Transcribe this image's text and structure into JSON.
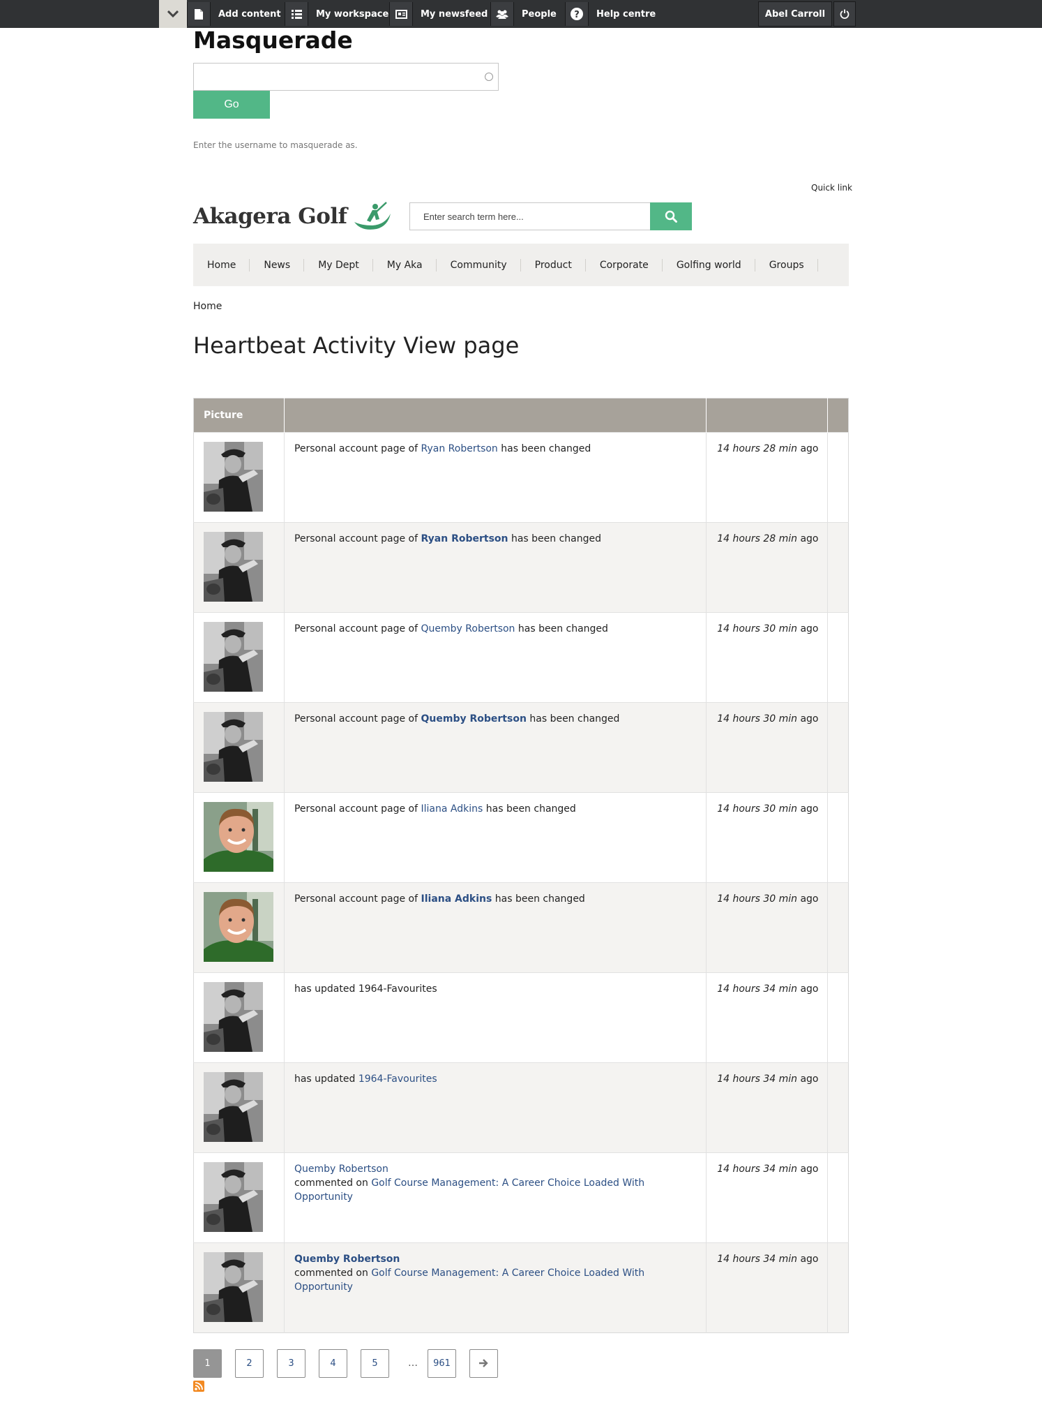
{
  "toolbar": {
    "items": [
      {
        "label": "Add content",
        "icon": "file-icon"
      },
      {
        "label": "My workspace",
        "icon": "list-icon"
      },
      {
        "label": "My newsfeed",
        "icon": "newspaper-icon"
      },
      {
        "label": "People",
        "icon": "users-icon"
      },
      {
        "label": "Help centre",
        "icon": "question-icon"
      }
    ],
    "user": "Abel Carroll"
  },
  "masquerade": {
    "title": "Masquerade",
    "input_value": "",
    "go_label": "Go",
    "help": "Enter the username to masquerade as."
  },
  "header": {
    "quick_link": "Quick link",
    "logo_text": "Akagera Golf",
    "search_placeholder": "Enter search term here..."
  },
  "nav": [
    "Home",
    "News",
    "My Dept",
    "My Aka",
    "Community",
    "Product",
    "Corporate",
    "Golfing world",
    "Groups"
  ],
  "breadcrumb": "Home",
  "page_title": "Heartbeat Activity View page",
  "table": {
    "headers": [
      "Picture",
      "",
      "",
      ""
    ],
    "rows": [
      {
        "avatar": "bw",
        "pre": "Personal account page of ",
        "link": "Ryan Robertson",
        "bold": false,
        "post": " has been changed",
        "t1": "14 hours",
        "t2": "28 min",
        "t3": " ago"
      },
      {
        "avatar": "bw",
        "pre": "Personal account page of ",
        "link": "Ryan Robertson",
        "bold": true,
        "post": " has been changed",
        "t1": "14 hours",
        "t2": "28 min",
        "t3": " ago"
      },
      {
        "avatar": "bw",
        "pre": "Personal account page of ",
        "link": "Quemby Robertson",
        "bold": false,
        "post": " has been changed",
        "t1": "14 hours",
        "t2": "30 min",
        "t3": " ago"
      },
      {
        "avatar": "bw",
        "pre": "Personal account page of ",
        "link": "Quemby Robertson",
        "bold": true,
        "post": " has been changed",
        "t1": "14 hours",
        "t2": "30 min",
        "t3": " ago"
      },
      {
        "avatar": "face",
        "pre": "Personal account page of ",
        "link": "Iliana Adkins",
        "bold": false,
        "post": " has been changed",
        "t1": "14 hours",
        "t2": "30 min",
        "t3": " ago"
      },
      {
        "avatar": "face",
        "pre": "Personal account page of ",
        "link": "Iliana Adkins",
        "bold": true,
        "post": " has been changed",
        "t1": "14 hours",
        "t2": "30 min",
        "t3": " ago"
      },
      {
        "avatar": "bw",
        "pre": "has updated 1964-Favourites",
        "link": "",
        "bold": false,
        "post": "",
        "t1": "14 hours",
        "t2": "34 min",
        "t3": " ago"
      },
      {
        "avatar": "bw",
        "pre": "has updated ",
        "link": "1964-Favourites",
        "bold": false,
        "post": "",
        "t1": "14 hours",
        "t2": "34 min",
        "t3": " ago"
      },
      {
        "avatar": "bw",
        "author": "Quemby Robertson",
        "author_bold": false,
        "pre": "commented on ",
        "link": "Golf Course Management: A Career Choice Loaded With Opportunity",
        "bold": false,
        "post": "",
        "t1": "14 hours",
        "t2": "34 min",
        "t3": " ago"
      },
      {
        "avatar": "bw",
        "author": "Quemby Robertson",
        "author_bold": true,
        "pre": "commented on ",
        "link": "Golf Course Management: A Career Choice Loaded With Opportunity",
        "bold": false,
        "post": "",
        "t1": "14 hours",
        "t2": "34 min",
        "t3": " ago"
      }
    ]
  },
  "pager": {
    "pages": [
      "1",
      "2",
      "3",
      "4",
      "5"
    ],
    "active": "1",
    "ellipsis": "…",
    "last": "961"
  },
  "colors": {
    "toolbar_bg": "#303234",
    "accent_green": "#52b787",
    "table_header_bg": "#a7a29a",
    "link": "#2c4f84",
    "nav_bg": "#f0efed"
  }
}
